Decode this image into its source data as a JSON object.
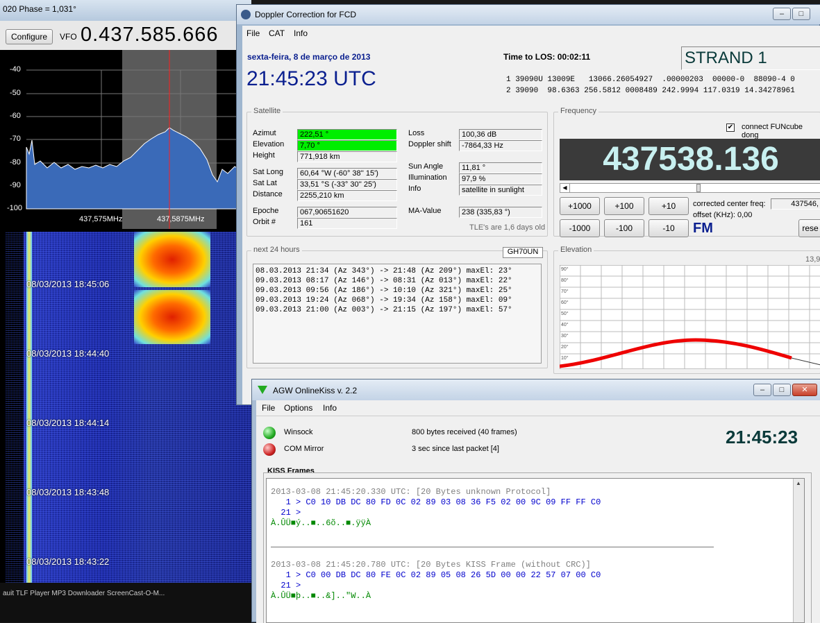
{
  "sdr": {
    "title_fragment": "020 Phase = 1,031°",
    "configure_label": "Configure",
    "vfo_label": "VFO",
    "vfo_value": "0.437.585.666",
    "spectrum": {
      "y_ticks": [
        "-40",
        "-50",
        "-60",
        "-70",
        "-80",
        "-90",
        "-100"
      ],
      "x_ticks": [
        "437,575MHz",
        "437,5875MHz"
      ]
    },
    "waterfall_times": [
      "08/03/2013 18:45:06",
      "08/03/2013 18:44:40",
      "08/03/2013 18:44:14",
      "08/03/2013 18:43:48",
      "08/03/2013 18:43:22"
    ],
    "taskbar_text": "auit    TLF Player    MP3 Downloader   ScreenCast-O-M..."
  },
  "doppler": {
    "title": "Doppler Correction for FCD",
    "menu": [
      "File",
      "CAT",
      "Info"
    ],
    "date": "sexta-feira, 8 de março de 2013",
    "time_utc": "21:45:23 UTC",
    "time_to_los_label": "Time to LOS: 00:02:11",
    "satellite_name": "STRAND 1",
    "tle_line1": "1 39090U 13009E   13066.26054927  .00000203  00000-0  88090-4 0",
    "tle_line2": "2 39090  98.6363 256.5812 0008489 242.9994 117.0319 14.34278961",
    "satellite_group": "Satellite",
    "sat": {
      "azimut_label": "Azimut",
      "azimut": "222,51 °",
      "elevation_label": "Elevation",
      "elevation": "7,70 °",
      "height_label": "Height",
      "height": "771,918 km",
      "satlong_label": "Sat Long",
      "satlong": "60,64 °W  (-60° 38'' 15')",
      "satlat_label": "Sat Lat",
      "satlat": "33,51 °S  (-33° 30'' 25')",
      "distance_label": "Distance",
      "distance": "2255,210 km",
      "epoche_label": "Epoche",
      "epoche": "067,90651620",
      "orbit_label": "Orbit #",
      "orbit": "161",
      "loss_label": "Loss",
      "loss": "100,36 dB",
      "doppler_label": "Doppler shift",
      "doppler": "-7864,33 Hz",
      "sunangle_label": "Sun Angle",
      "sunangle": "11,81 °",
      "illum_label": "Illumination",
      "illum": "97,9 %",
      "info_label": "Info",
      "info": "satellite in sunlight",
      "ma_label": "MA-Value",
      "ma": "238  (335,83 °)",
      "tle_age": "TLE's are 1,6 days old"
    },
    "frequency_group": "Frequency",
    "connect_label": "connect FUNcube dong",
    "frequency": "437538.136",
    "buttons_row1": [
      "+1000",
      "+100",
      "+10"
    ],
    "buttons_row2": [
      "-1000",
      "-100",
      "-10"
    ],
    "corrected_label": "corrected center freq:",
    "corrected_value": "437546,",
    "offset_label": "offset (KHz): 0,00",
    "mode": "FM",
    "reset_label": "rese",
    "next_group": "next 24 hours",
    "locator": "GH70UN",
    "passes": [
      "08.03.2013 21:34 (Az 343°) -> 21:48 (Az 209°) maxEl: 23°",
      "09.03.2013 08:17 (Az 146°) -> 08:31 (Az 013°) maxEl: 22°",
      "09.03.2013 09:56 (Az 186°) -> 10:10 (Az 321°) maxEl: 25°",
      "09.03.2013 19:24 (Az 068°) -> 19:34 (Az 158°) maxEl: 09°",
      "09.03.2013 21:00 (Az 003°) -> 21:15 (Az 197°) maxEl: 57°"
    ],
    "elevation_group": "Elevation",
    "elev_corner": "13,9",
    "elev_ticks": [
      "90°",
      "80°",
      "70°",
      "60°",
      "50°",
      "40°",
      "30°",
      "20°",
      "10°"
    ]
  },
  "agw": {
    "title": "AGW OnlineKiss v. 2.2",
    "menu": [
      "File",
      "Options",
      "Info"
    ],
    "winsock_label": "Winsock",
    "winsock_status": "800 bytes received (40 frames)",
    "com_label": "COM Mirror",
    "com_status": "3 sec since last packet [4]",
    "clock": "21:45:23",
    "kiss_title": "KISS Frames",
    "frame1_header": "2013-03-08 21:45:20.330 UTC: [20 Bytes unknown Protocol]",
    "frame1_hex1": "   1 > C0 10 DB DC 80 FD 0C 02 89 03 08 36 F5 02 00 9C 09 FF FF C0",
    "frame1_hex2": "  21 >",
    "frame1_ascii": "À.ÛÜ■ý..■..6õ..■.ÿÿÀ",
    "frame2_header": "2013-03-08 21:45:20.780 UTC: [20 Bytes KISS Frame (without CRC)]",
    "frame2_hex1": "   1 > C0 00 DB DC 80 FE 0C 02 89 05 08 26 5D 00 00 22 57 07 00 C0",
    "frame2_hex2": "  21 >",
    "frame2_ascii": "À.ÛÜ■þ..■..&]..\"W..À"
  },
  "colors": {
    "doppler_blue": "#0a1f8f",
    "freq_bg": "#3a3a3a",
    "freq_fg": "#c8f0f0",
    "field_green": "#00ee00",
    "hex_blue": "#0000cc",
    "ascii_green": "#008800",
    "elev_curve": "#ee0000"
  }
}
